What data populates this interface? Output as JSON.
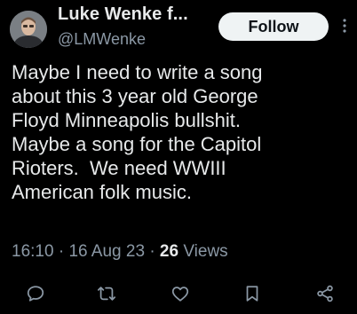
{
  "author": {
    "name": "Luke Wenke f...",
    "handle": "@LMWenke"
  },
  "follow_label": "Follow",
  "tweet": {
    "lines": [
      "Maybe I need to write a song",
      "about this 3 year old George",
      "Floyd Minneapolis bullshit.",
      "Maybe a song for the Capitol",
      "Rioters.  We need WWIII",
      "American folk music."
    ]
  },
  "meta": {
    "time": "16:10",
    "separator": "·",
    "date": "16 Aug 23",
    "views_count": "26",
    "views_label": "Views"
  },
  "actions": [
    {
      "icon": "reply-icon"
    },
    {
      "icon": "retweet-icon"
    },
    {
      "icon": "like-icon"
    },
    {
      "icon": "bookmark-icon"
    },
    {
      "icon": "share-icon"
    }
  ],
  "colors": {
    "background": "#000000",
    "text": "#e7e9ea",
    "secondary": "#8b98a5",
    "follow_bg": "#eff3f4"
  }
}
